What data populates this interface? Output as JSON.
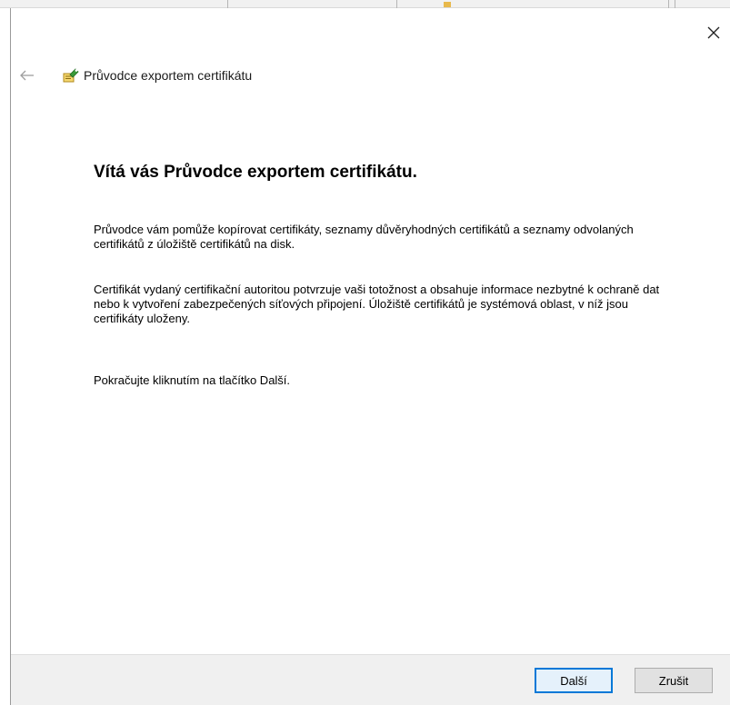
{
  "dialog": {
    "title": "Průvodce exportem certifikátu",
    "heading": "Vítá vás Průvodce exportem certifikátu.",
    "paragraphs": [
      "Průvodce vám pomůže kopírovat certifikáty, seznamy důvěryhodných certifikátů a seznamy odvolaných certifikátů z úložiště certifikátů na disk.",
      "Certifikát vydaný certifikační autoritou potvrzuje vaši totožnost a obsahuje informace nezbytné k ochraně dat nebo k vytvoření zabezpečených síťových připojení. Úložiště certifikátů je systémová oblast, v níž jsou certifikáty uloženy.",
      "Pokračujte kliknutím na tlačítko Další."
    ]
  },
  "buttons": {
    "next_label": "Další",
    "cancel_label": "Zrušit"
  },
  "icons": {
    "close": "close-icon",
    "back": "back-arrow-icon",
    "wizard": "certificate-wizard-icon"
  },
  "colors": {
    "accent": "#0078d7",
    "footer_bg": "#f0f0f0"
  }
}
